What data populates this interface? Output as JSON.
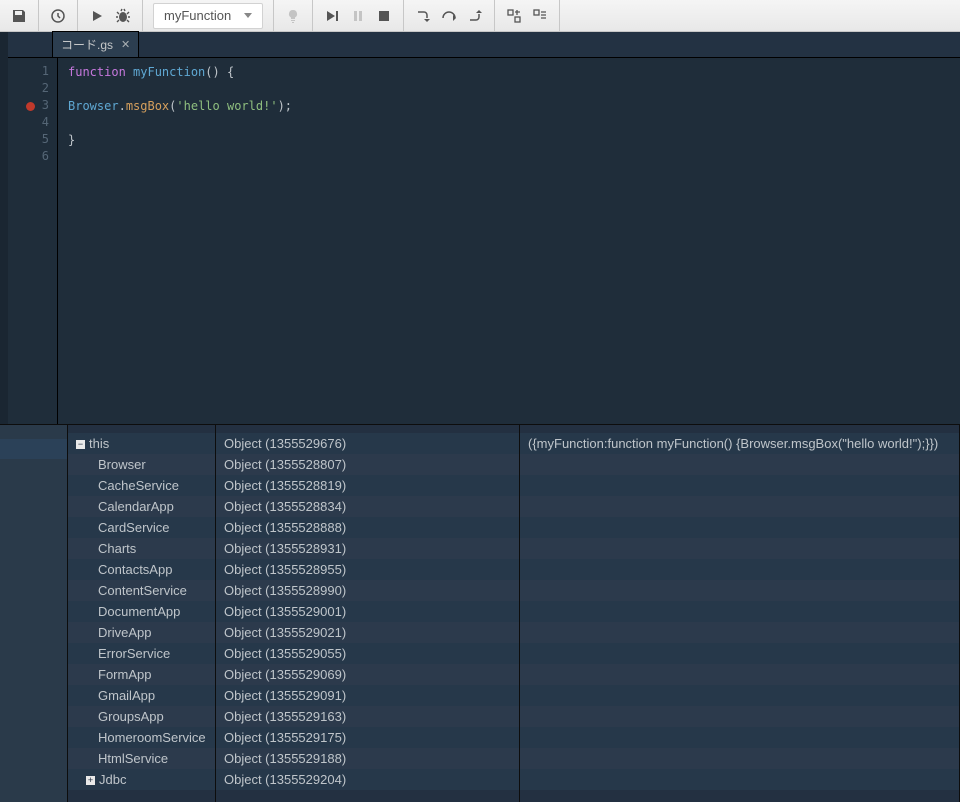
{
  "toolbar": {
    "function_selected": "myFunction"
  },
  "tab": {
    "filename": "コード.gs"
  },
  "code": {
    "lines": [
      "1",
      "2",
      "3",
      "4",
      "5",
      "6"
    ],
    "breakpoint_line": 3,
    "t_function": "function",
    "t_fnname": "myFunction",
    "t_parens_open": "() {",
    "t_browser": "Browser",
    "t_dot": ".",
    "t_msgbox": "msgBox",
    "t_open_call": "(",
    "t_string": "'hello world!'",
    "t_close_call": ");",
    "t_close_brace": "}"
  },
  "scope": {
    "root_label": "this",
    "root_type": "Object (1355529676)",
    "root_preview": "({myFunction:function myFunction() {Browser.msgBox(\"hello world!\");}})",
    "items": [
      {
        "name": "Browser",
        "type": "Object (1355528807)"
      },
      {
        "name": "CacheService",
        "type": "Object (1355528819)"
      },
      {
        "name": "CalendarApp",
        "type": "Object (1355528834)"
      },
      {
        "name": "CardService",
        "type": "Object (1355528888)"
      },
      {
        "name": "Charts",
        "type": "Object (1355528931)"
      },
      {
        "name": "ContactsApp",
        "type": "Object (1355528955)"
      },
      {
        "name": "ContentService",
        "type": "Object (1355528990)"
      },
      {
        "name": "DocumentApp",
        "type": "Object (1355529001)"
      },
      {
        "name": "DriveApp",
        "type": "Object (1355529021)"
      },
      {
        "name": "ErrorService",
        "type": "Object (1355529055)"
      },
      {
        "name": "FormApp",
        "type": "Object (1355529069)"
      },
      {
        "name": "GmailApp",
        "type": "Object (1355529091)"
      },
      {
        "name": "GroupsApp",
        "type": "Object (1355529163)"
      },
      {
        "name": "HomeroomService",
        "type": "Object (1355529175)"
      },
      {
        "name": "HtmlService",
        "type": "Object (1355529188)"
      },
      {
        "name": "Jdbc",
        "type": "Object (1355529204)"
      }
    ]
  }
}
